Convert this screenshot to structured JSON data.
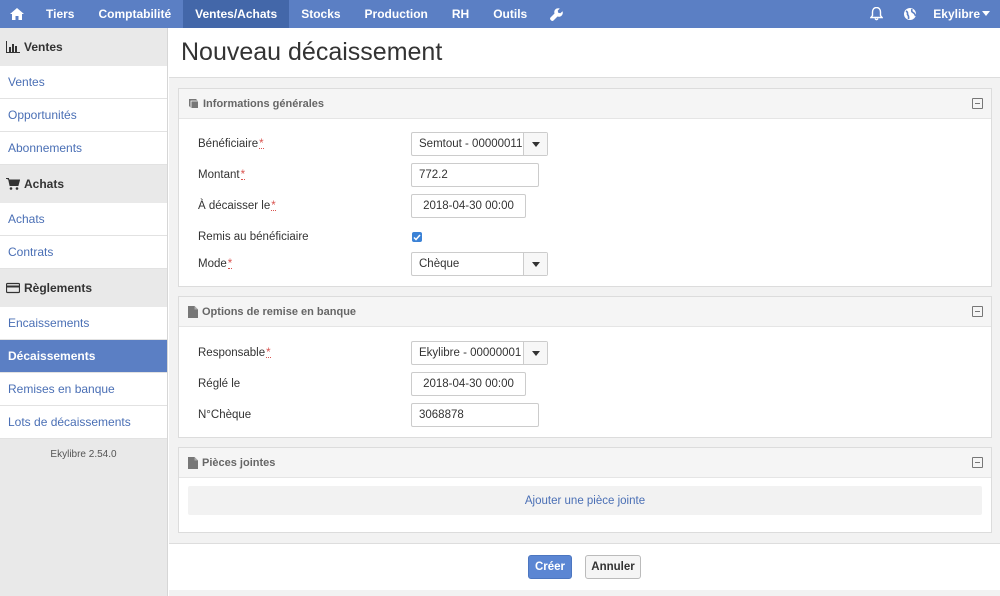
{
  "topnav": {
    "items": [
      {
        "label": "Tiers",
        "active": false
      },
      {
        "label": "Comptabilité",
        "active": false
      },
      {
        "label": "Ventes/Achats",
        "active": true
      },
      {
        "label": "Stocks",
        "active": false
      },
      {
        "label": "Production",
        "active": false
      },
      {
        "label": "RH",
        "active": false
      },
      {
        "label": "Outils",
        "active": false
      }
    ],
    "user": "Ekylibre"
  },
  "sidebar": {
    "sections": [
      {
        "title": "Ventes",
        "icon": "bar-chart-icon",
        "items": [
          "Ventes",
          "Opportunités",
          "Abonnements"
        ]
      },
      {
        "title": "Achats",
        "icon": "cart-icon",
        "items": [
          "Achats",
          "Contrats"
        ]
      },
      {
        "title": "Règlements",
        "icon": "credit-card-icon",
        "items": [
          "Encaissements",
          "Décaissements",
          "Remises en banque",
          "Lots de décaissements"
        ]
      }
    ],
    "active_item": "Décaissements",
    "version": "Ekylibre 2.54.0"
  },
  "page": {
    "title": "Nouveau décaissement"
  },
  "general": {
    "title": "Informations générales",
    "beneficiaire_label": "Bénéficiaire",
    "beneficiaire_value": "Semtout - 00000011",
    "montant_label": "Montant",
    "montant_value": "772.2",
    "decaisser_label": "À décaisser le",
    "decaisser_value": "2018-04-30 00:00",
    "remis_label": "Remis au bénéficiaire",
    "remis_checked": true,
    "mode_label": "Mode",
    "mode_value": "Chèque",
    "required_mark": "*"
  },
  "bank": {
    "title": "Options de remise en banque",
    "responsable_label": "Responsable",
    "responsable_value": "Ekylibre - 00000001",
    "regle_label": "Réglé le",
    "regle_value": "2018-04-30 00:00",
    "cheque_label": "N°Chèque",
    "cheque_value": "3068878"
  },
  "attachments": {
    "title": "Pièces jointes",
    "add_label": "Ajouter une pièce jointe"
  },
  "actions": {
    "create": "Créer",
    "cancel": "Annuler"
  },
  "colors": {
    "accent": "#5b7fc4",
    "nav_active": "#4367a9",
    "link": "#4a6fb5"
  }
}
